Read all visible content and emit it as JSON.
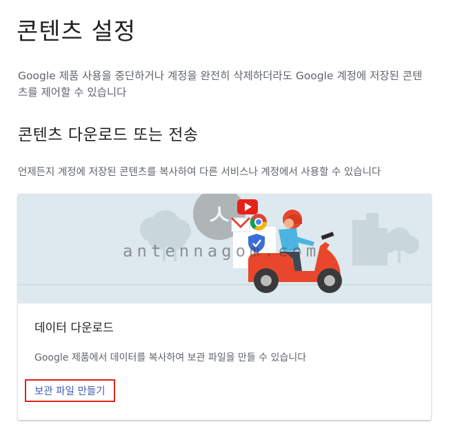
{
  "page": {
    "title": "콘텐츠 설정",
    "intro": "Google 제품 사용을 중단하거나 계정을 완전히 삭제하더라도 Google 계정에 저장된 콘텐츠를 제어할 수 있습니다"
  },
  "section": {
    "title": "콘텐츠 다운로드 또는 전송",
    "description": "언제든지 계정에 저장된 콘텐츠를 복사하여 다른 서비스나 계정에서 사용할 수 있습니다"
  },
  "card": {
    "title": "데이터 다운로드",
    "description": "Google 제품에서 데이터를 복사하여 보관 파일을 만들 수 있습니다",
    "action_label": "보관 파일 만들기",
    "illustration_icons": [
      "youtube-icon",
      "gmail-icon",
      "chrome-icon",
      "shield-icon"
    ]
  },
  "watermark": {
    "text": "antennagom.com",
    "logo_char": "ㅅ"
  },
  "colors": {
    "hero_bg": "#dde9ef",
    "scooter": "#e8472b",
    "link": "#3b5bb5",
    "highlight_box": "#e0201b"
  }
}
